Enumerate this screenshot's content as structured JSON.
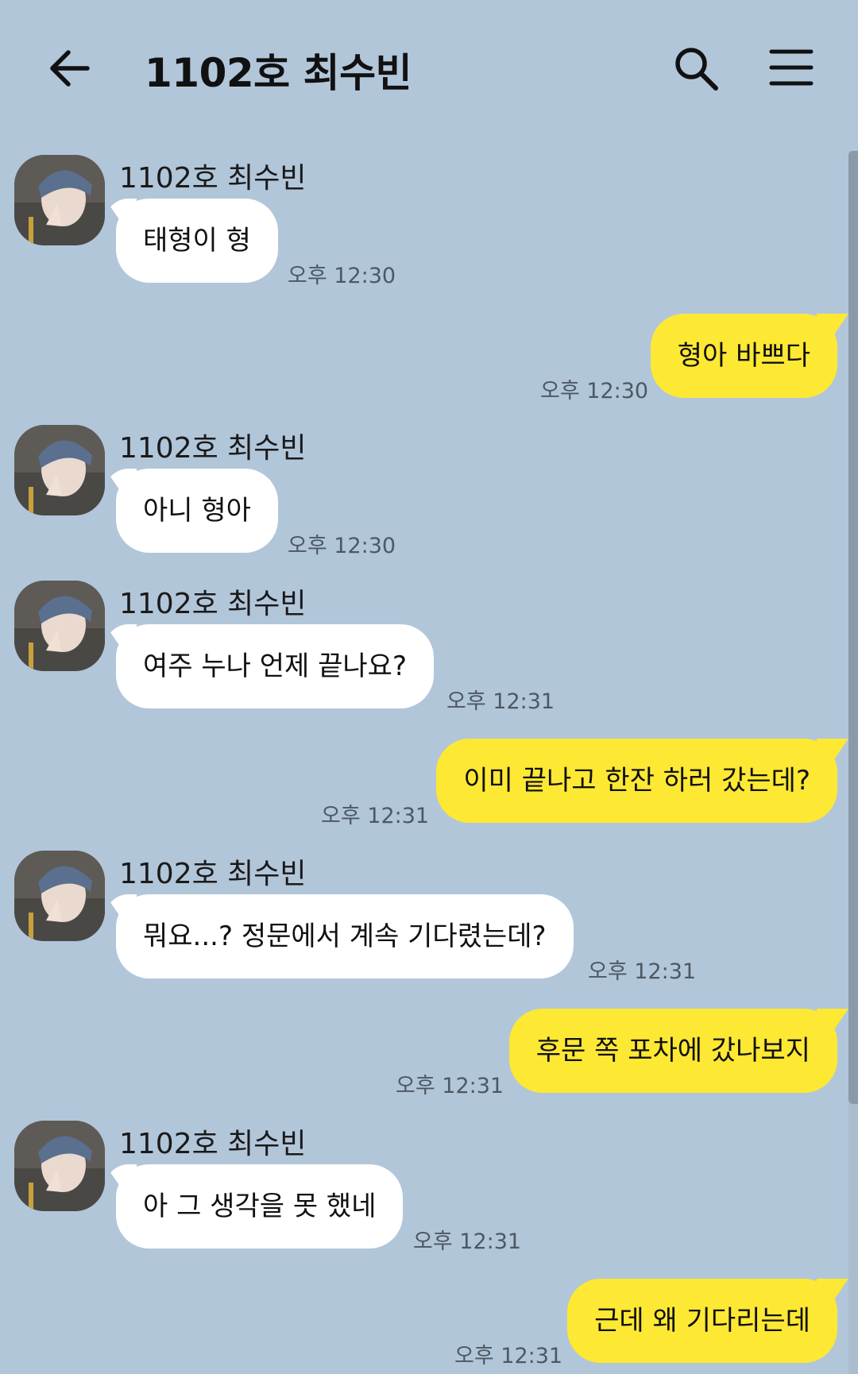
{
  "header": {
    "title": "1102호 최수빈"
  },
  "messages": [
    {
      "sender": "1102호 최수빈",
      "text": "태형이 형",
      "time": "오후 12:30"
    },
    {
      "text": "형아 바쁘다",
      "time": "오후 12:30"
    },
    {
      "sender": "1102호 최수빈",
      "text": "아니 형아",
      "time": "오후 12:30"
    },
    {
      "sender": "1102호 최수빈",
      "text": "여주 누나 언제 끝나요?",
      "time": "오후 12:31"
    },
    {
      "text": "이미 끝나고 한잔 하러 갔는데?",
      "time": "오후 12:31"
    },
    {
      "sender": "1102호 최수빈",
      "text": "뭐요...? 정문에서 계속 기다렸는데?",
      "time": "오후 12:31"
    },
    {
      "text": "후문 쪽 포차에 갔나보지",
      "time": "오후 12:31"
    },
    {
      "sender": "1102호 최수빈",
      "text": "아 그 생각을 못 했네",
      "time": "오후 12:31"
    },
    {
      "text": "근데 왜 기다리는데",
      "time": "오후 12:31"
    }
  ],
  "colors": {
    "background": "#b2c6da",
    "outgoing_bubble": "#fde834",
    "incoming_bubble": "#ffffff"
  },
  "icons": {
    "back": "arrow-left-icon",
    "search": "search-icon",
    "menu": "hamburger-menu-icon",
    "avatar": "profile-photo"
  }
}
